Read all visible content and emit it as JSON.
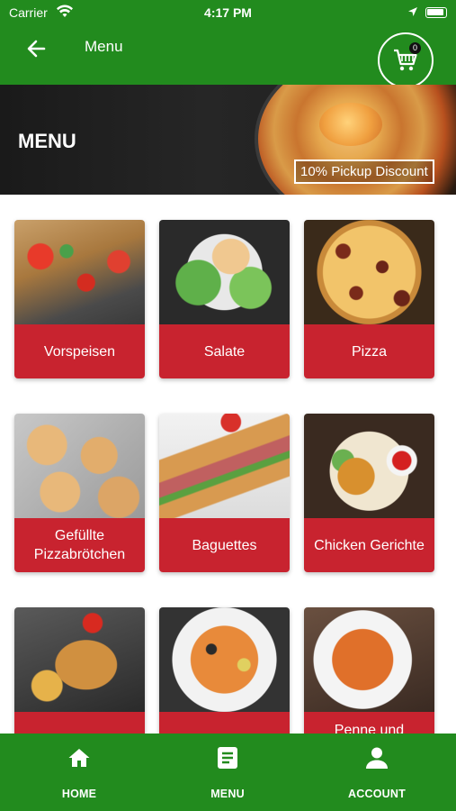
{
  "status_bar": {
    "carrier": "Carrier",
    "time": "4:17 PM"
  },
  "header": {
    "title": "Menu",
    "cart_count": "0"
  },
  "hero": {
    "heading": "MENU",
    "discount": "10% Pickup Discount"
  },
  "categories": [
    {
      "label": "Vorspeisen"
    },
    {
      "label": "Salate"
    },
    {
      "label": "Pizza"
    },
    {
      "label": "Gefüllte Pizzabrötchen"
    },
    {
      "label": "Baguettes"
    },
    {
      "label": "Chicken Gerichte"
    },
    {
      "label": ""
    },
    {
      "label": ""
    },
    {
      "label": "Penne und"
    }
  ],
  "bottom_nav": [
    {
      "label": "HOME",
      "icon": "home-icon"
    },
    {
      "label": "MENU",
      "icon": "menu-book-icon"
    },
    {
      "label": "ACCOUNT",
      "icon": "person-icon"
    }
  ],
  "colors": {
    "primary_green": "#228B1E",
    "category_red": "#C8232F"
  }
}
